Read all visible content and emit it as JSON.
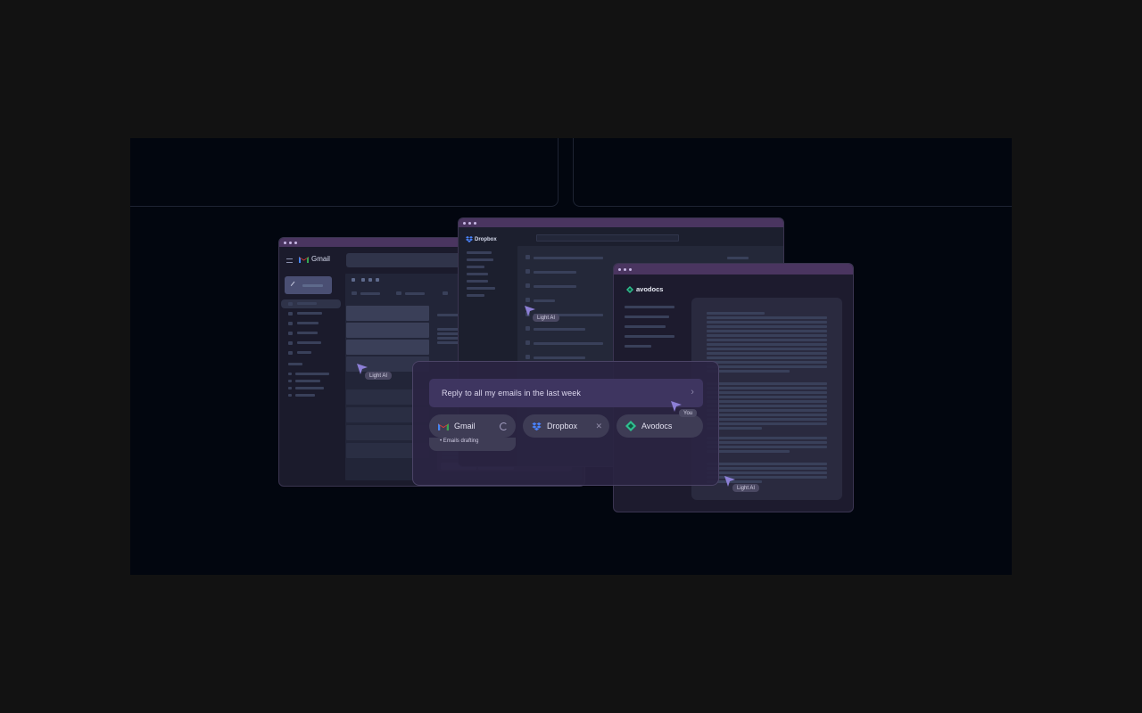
{
  "gmail_window": {
    "app_name": "Gmail"
  },
  "dropbox_window": {
    "app_name": "Dropbox"
  },
  "avodocs_window": {
    "app_name": "avodocs"
  },
  "prompt": {
    "text": "Reply to all my emails in the last week"
  },
  "integrations": [
    {
      "label": "Gmail",
      "status_note": "Emails drafting"
    },
    {
      "label": "Dropbox"
    },
    {
      "label": "Avodocs"
    }
  ],
  "cursors": {
    "gmail_agent": "Light AI",
    "dropbox_agent": "Light AI",
    "avodocs_agent": "Light AI",
    "user": "You"
  },
  "colors": {
    "accent": "#8c7fd6",
    "background": "#02060f",
    "titlebar": "#4a3560"
  }
}
